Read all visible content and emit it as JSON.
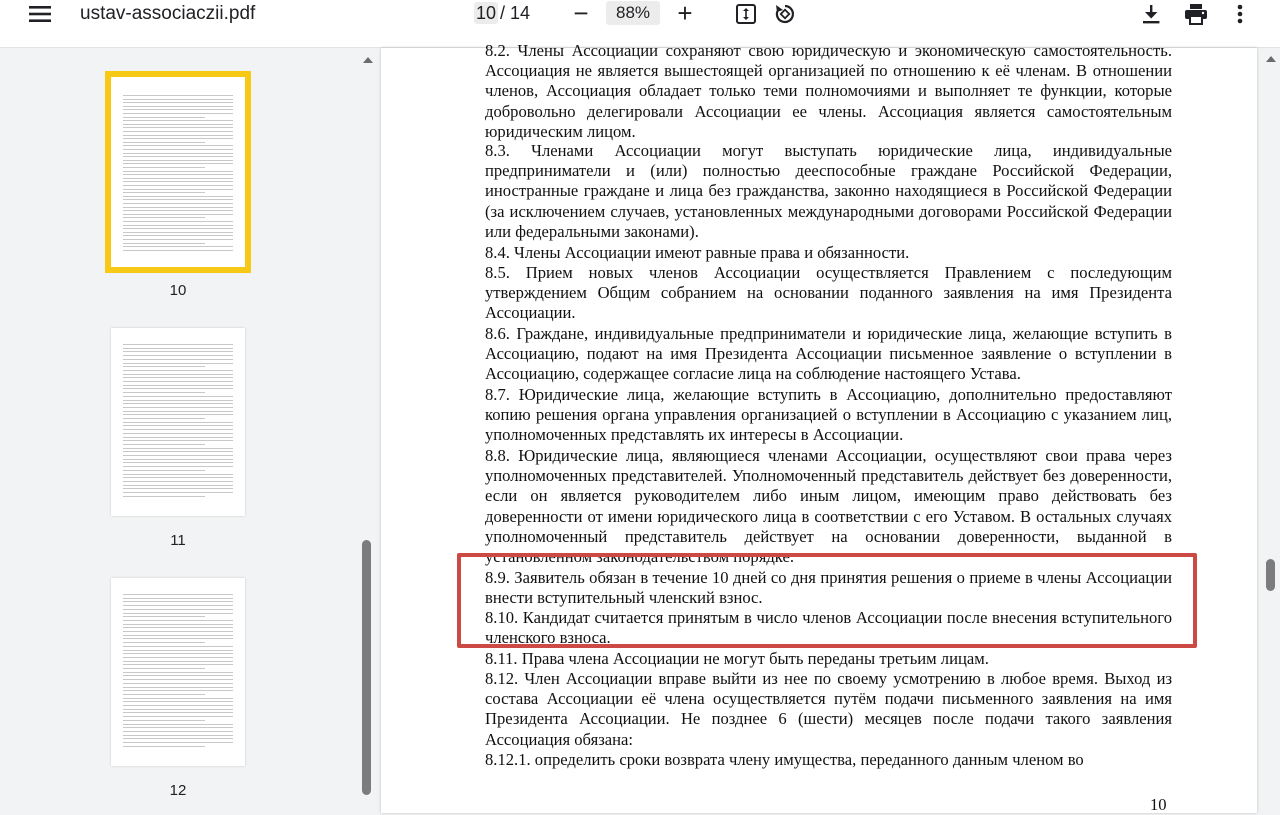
{
  "toolbar": {
    "file_name": "ustav-associaczii.pdf",
    "current_page": "10",
    "total_pages": "/ 14",
    "zoom_out": "−",
    "zoom_level": "88%",
    "zoom_in": "+",
    "icons": [
      "menu-icon",
      "fit-page-icon",
      "rotate-icon",
      "download-icon",
      "print-icon",
      "more-vert-icon"
    ]
  },
  "sidebar": {
    "thumbnails": [
      {
        "label": "10",
        "selected": true
      },
      {
        "label": "11",
        "selected": false
      },
      {
        "label": "12",
        "selected": false
      }
    ],
    "selected_color": "#f7c815"
  },
  "document": {
    "paragraphs": [
      "8.2. Члены Ассоциации сохраняют свою юридическую и экономическую самостоятельность. Ассоциация не является вышестоящей организацией по отношению к её членам. В отношении членов, Ассоциация обладает только теми полномочиями и выполняет те функции, которые добровольно делегировали Ассоциации ее члены. Ассоциация является самостоятельным юридическим лицом.",
      "8.3. Членами Ассоциации могут выступать юридические лица, индивидуальные предприниматели и (или) полностью дееспособные граждане Российской Федерации, иностранные граждане и лица без гражданства, законно находящиеся в Российской Федерации (за исключением случаев, установленных международными договорами Российской Федерации или федеральными законами).",
      "8.4. Члены Ассоциации имеют равные права и обязанности.",
      "8.5. Прием новых членов Ассоциации осуществляется Правлением с последующим утверждением Общим собранием на основании поданного заявления на имя Президента Ассоциации.",
      "8.6. Граждане, индивидуальные предприниматели и юридические лица, желающие вступить в Ассоциацию, подают на имя Президента Ассоциации письменное заявление о вступлении в Ассоциацию, содержащее согласие лица на соблюдение настоящего Устава.",
      "8.7. Юридические лица, желающие вступить в Ассоциацию, дополнительно предоставляют копию решения органа управления организацией о вступлении в Ассоциацию с указанием лиц, уполномоченных представлять их интересы в Ассоциации.",
      "8.8. Юридические лица, являющиеся членами Ассоциации, осуществляют свои права через уполномоченных представителей. Уполномоченный представитель действует без доверенности, если он является руководителем либо иным лицом, имеющим право действовать без доверенности от имени юридического лица в соответствии с его Уставом. В остальных случаях уполномоченный представитель действует на основании доверенности, выданной в установленном законодательством порядке.",
      "8.9. Заявитель обязан в течение 10 дней со дня принятия решения о приеме в члены Ассоциации внести вступительный членский взнос.",
      "8.10. Кандидат считается принятым в число членов Ассоциации после внесения вступительного членского взноса.",
      "8.11. Права члена Ассоциации не могут быть переданы третьим лицам.",
      "8.12. Член Ассоциации вправе выйти из нее по своему усмотрению в любое время. Выход из состава Ассоциации её члена осуществляется путём подачи письменного заявления на имя Президента Ассоциации. Не позднее 6 (шести) месяцев после подачи такого заявления Ассоциация обязана:",
      "8.12.1. определить сроки возврата члену имущества, переданного данным членом во"
    ],
    "page_number": "10",
    "highlight_color": "#cc4a43"
  }
}
